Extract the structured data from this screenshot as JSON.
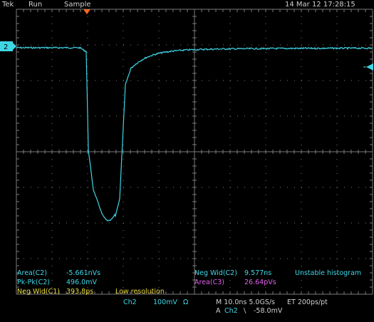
{
  "status": {
    "brand": "Tek",
    "run_state": "Run",
    "acq_mode": "Sample",
    "datetime": "14 Mar 12 17:28:15"
  },
  "channel_marker": {
    "label": "2"
  },
  "colors": {
    "ch1": "#e8d83c",
    "ch2": "#3fd6e6",
    "ch3": "#e060e8",
    "grid": "#7a7a7a",
    "trigger": "#ff6a1a",
    "background": "#000000"
  },
  "measurements": {
    "left": [
      {
        "label": "Area(C2)",
        "value": "-5.661nVs",
        "color": "ch2"
      },
      {
        "label": "Pk-Pk(C2)",
        "value": "496.0mV",
        "color": "ch2"
      },
      {
        "label": "Neg Wid(C1)",
        "value": "393.8ps",
        "color": "ch1",
        "note": "Low resolution"
      }
    ],
    "right": [
      {
        "label": "Neg Wid(C2)",
        "value": "9.577ns",
        "color": "ch2",
        "note": "Unstable histogram"
      },
      {
        "label": "Area(C3)",
        "value": "26.64pVs",
        "color": "ch3"
      }
    ]
  },
  "bottom": {
    "channel": "Ch2",
    "volts_per_div": "100mV",
    "impedance": "Ω",
    "timebase": "M 10.0ns 5.0GS/s",
    "et": "ET 200ps/pt",
    "trig_mode": "A",
    "trig_source": "Ch2",
    "trig_slope": "\\",
    "trig_level": "-58.0mV"
  }
}
